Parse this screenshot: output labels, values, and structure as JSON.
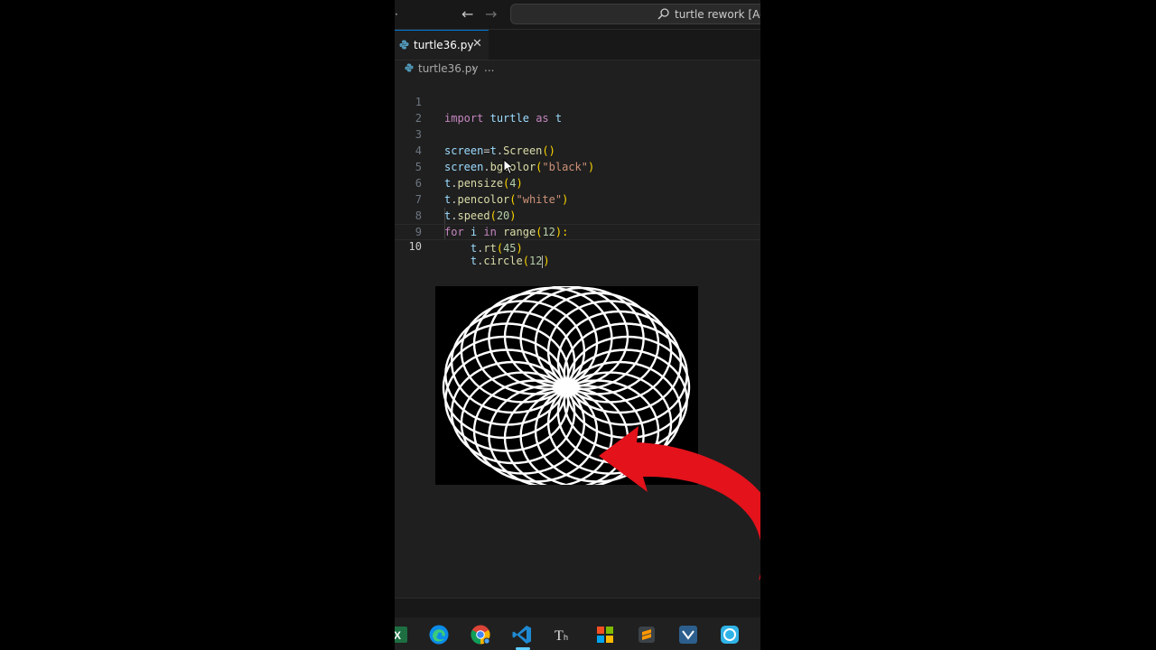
{
  "titlebar": {
    "menu_glyph": "·",
    "search_text": "turtle rework [Admi"
  },
  "tab": {
    "label": "turtle36.py",
    "close_glyph": "✕"
  },
  "breadcrumb": {
    "file": "turtle36.py",
    "separator": "›",
    "more": "..."
  },
  "editor": {
    "active_line": 10,
    "lines": [
      {
        "num": "1"
      },
      {
        "num": "2"
      },
      {
        "num": "3"
      },
      {
        "num": "4"
      },
      {
        "num": "5"
      },
      {
        "num": "6"
      },
      {
        "num": "7"
      },
      {
        "num": "8"
      },
      {
        "num": "9"
      },
      {
        "num": "10"
      }
    ],
    "tokens": {
      "l1_import": "import",
      "l1_turtle": "turtle",
      "l1_as": "as",
      "l1_t": "t",
      "l3_screen": "screen",
      "l3_eq": "=",
      "l3_t": "t",
      "l3_dot": ".",
      "l3_Screen": "Screen",
      "l3_paren": "()",
      "l4_screen": "screen",
      "l4_dot": ".",
      "l4_bgcolor": "bgcolor",
      "l4_open": "(",
      "l4_str": "\"black\"",
      "l4_close": ")",
      "l5_t": "t",
      "l5_dot": ".",
      "l5_pensize": "pensize",
      "l5_open": "(",
      "l5_num": "4",
      "l5_close": ")",
      "l6_t": "t",
      "l6_dot": ".",
      "l6_pencolor": "pencolor",
      "l6_open": "(",
      "l6_str": "\"white\"",
      "l6_close": ")",
      "l7_t": "t",
      "l7_dot": ".",
      "l7_speed": "speed",
      "l7_open": "(",
      "l7_num": "20",
      "l7_close": ")",
      "l8_for": "for",
      "l8_i": "i",
      "l8_in": "in",
      "l8_range": "range",
      "l8_open": "(",
      "l8_num": "12",
      "l8_close": "):",
      "l9_t": "t",
      "l9_dot": ".",
      "l9_rt": "rt",
      "l9_open": "(",
      "l9_num": "45",
      "l9_close": ")",
      "l10_t": "t",
      "l10_dot": ".",
      "l10_circle": "circle",
      "l10_open": "(",
      "l10_num": "12",
      "l10_close": ")"
    }
  },
  "turtle_output": {
    "background": "#000000",
    "pen_color": "#ffffff",
    "pen_size": 4,
    "circle_count": 24
  },
  "overlay": {
    "arrow_color": "#e3121b"
  },
  "taskbar": {
    "icons": [
      "excel-icon",
      "edge-icon",
      "chrome-icon",
      "vscode-icon",
      "typora-icon",
      "office-icon",
      "sublime-icon",
      "visual-studio-icon",
      "app-icon"
    ],
    "active": "vscode-icon"
  }
}
